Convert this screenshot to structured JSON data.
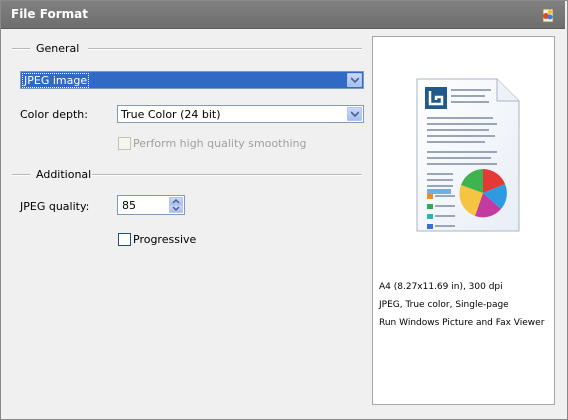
{
  "window": {
    "title": "File Format",
    "title_icon": "settings-image-icon"
  },
  "general": {
    "section_label": "General",
    "format_value": "JPEG image",
    "color_depth_label": "Color depth:",
    "color_depth_value": "True Color (24 bit)",
    "smoothing_label": "Perform high quality smoothing",
    "smoothing_checked": false,
    "smoothing_enabled": false
  },
  "additional": {
    "section_label": "Additional",
    "quality_label": "JPEG quality:",
    "quality_value": "85",
    "progressive_label": "Progressive",
    "progressive_checked": false
  },
  "preview": {
    "icon": "document-chart-icon",
    "line1": "A4 (8.27x11.69 in), 300 dpi",
    "line2": "JPEG, True color, Single-page",
    "line3": "Run Windows Picture and Fax Viewer"
  },
  "colors": {
    "accent": "#316ac5",
    "titlebar": "#6e6e6e",
    "panel": "#f0f0f0"
  }
}
